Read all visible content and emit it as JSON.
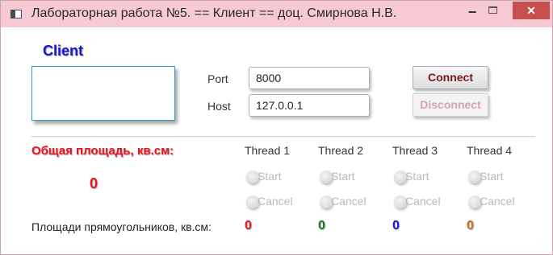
{
  "window": {
    "title": "Лабораторная работа №5. == Клиент == доц. Смирнова Н.В.",
    "minimize_glyph": "−",
    "close_glyph": "✕"
  },
  "client": {
    "heading": "Client",
    "status_text": ""
  },
  "connection": {
    "port_label": "Port",
    "port_value": "8000",
    "host_label": "Host",
    "host_value": "127.0.0.1",
    "connect_label": "Connect",
    "disconnect_label": "Disconnect"
  },
  "summary": {
    "total_label": "Общая площадь, кв.см:",
    "total_value": "0",
    "areas_label": "Площади прямоугольников, кв.см:"
  },
  "threads": [
    {
      "name": "Thread 1",
      "start_label": "Start",
      "cancel_label": "Cancel",
      "area": "0",
      "color": "#e8141d"
    },
    {
      "name": "Thread 2",
      "start_label": "Start",
      "cancel_label": "Cancel",
      "area": "0",
      "color": "#1f7a1f"
    },
    {
      "name": "Thread 3",
      "start_label": "Start",
      "cancel_label": "Cancel",
      "area": "0",
      "color": "#1518d6"
    },
    {
      "name": "Thread 4",
      "start_label": "Start",
      "cancel_label": "Cancel",
      "area": "0",
      "color": "#d2691e"
    }
  ]
}
